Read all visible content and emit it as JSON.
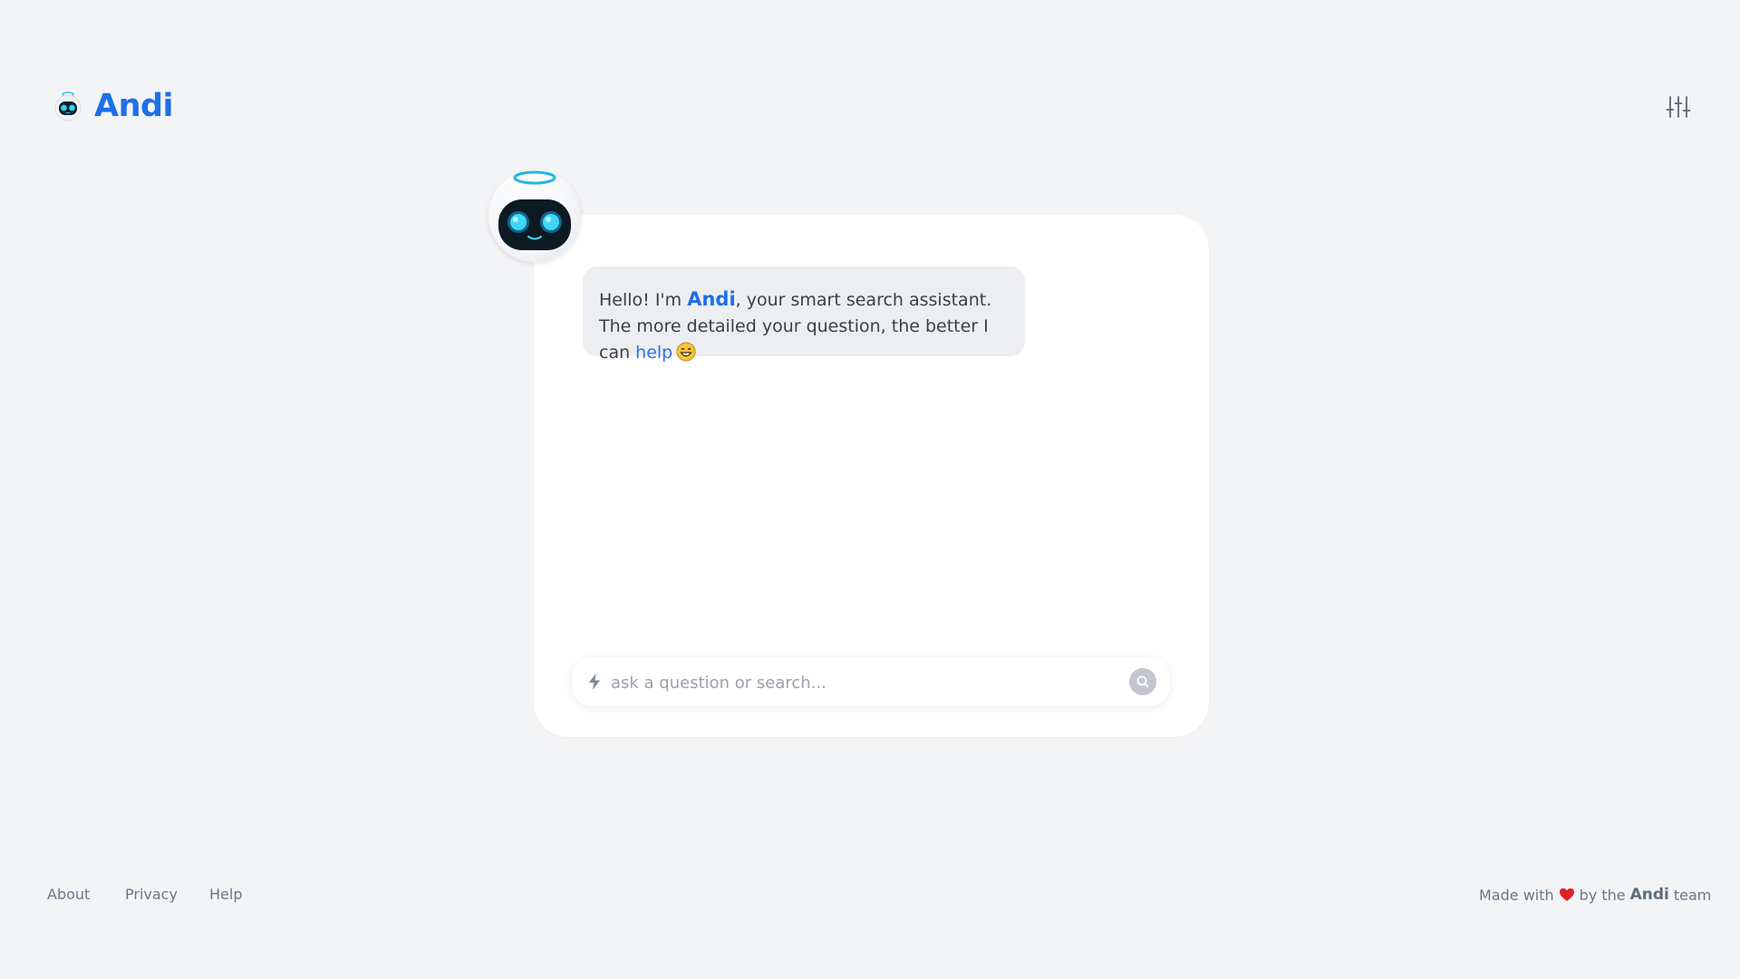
{
  "header": {
    "brand_name": "Andi",
    "logo_icon": "robot-logo-icon",
    "settings_icon": "sliders-icon"
  },
  "chat": {
    "avatar_icon": "robot-avatar-icon",
    "greeting": {
      "part1": "Hello! I'm ",
      "brand": "Andi",
      "part2": ", your smart search assistant. The more detailed your question, the better I can ",
      "link": "help",
      "emoji_icon": "grinning-face-icon"
    }
  },
  "search": {
    "placeholder": "ask a question or search...",
    "value": "",
    "bolt_icon": "lightning-bolt-icon",
    "submit_icon": "search-icon"
  },
  "footer": {
    "links": [
      "About",
      "Privacy",
      "Help"
    ],
    "made_with": "Made with",
    "by_the": "by the",
    "team_brand": "Andi",
    "team": "team",
    "heart_icon": "heart-icon"
  },
  "colors": {
    "background": "#f3f4f6",
    "card": "#ffffff",
    "brand_blue": "#1e6fe8",
    "bubble": "#eceef1",
    "heart": "#e0202a",
    "avatar_glow": "#2ec8f0"
  }
}
